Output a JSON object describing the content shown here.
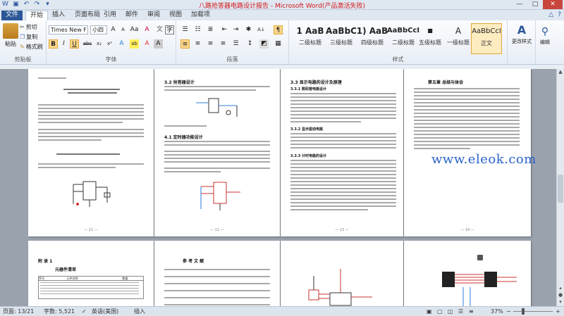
{
  "window": {
    "title": "八路抢答器电路设计报告 - Microsoft Word(产品激活失败)",
    "qat_icons": [
      "word-icon",
      "save-icon",
      "undo-icon",
      "redo-icon",
      "customize-icon"
    ],
    "controls": {
      "minimize": "—",
      "maximize": "□",
      "close": "✕"
    }
  },
  "tabs": [
    {
      "label": "文件"
    },
    {
      "label": "开始"
    },
    {
      "label": "插入"
    },
    {
      "label": "页面布局"
    },
    {
      "label": "引用"
    },
    {
      "label": "邮件"
    },
    {
      "label": "审阅"
    },
    {
      "label": "视图"
    },
    {
      "label": "加载项"
    }
  ],
  "tabs_right": {
    "minimize_ribbon": "△",
    "help": "?"
  },
  "ribbon": {
    "clipboard": {
      "label": "剪贴板",
      "paste": "粘贴",
      "cut": "剪切",
      "copy": "复制",
      "format_painter": "格式刷"
    },
    "font": {
      "label": "字体",
      "font_name": "Times New F",
      "font_size": "小四",
      "grow": "A",
      "shrink": "A",
      "case": "Aa",
      "clear": "A",
      "bold": "B",
      "italic": "I",
      "underline": "U",
      "strike": "abc",
      "sub": "x₂",
      "sup": "x²",
      "effects": "A",
      "highlight": "ab",
      "color": "A",
      "char_shade": "A",
      "enclose": "字"
    },
    "paragraph": {
      "label": "段落",
      "sort": "A↓",
      "marks": "¶"
    },
    "styles": {
      "label": "样式",
      "items": [
        {
          "sample": "1 AaB",
          "name": "二级标题"
        },
        {
          "sample": "AaBbC",
          "name": "三级标题"
        },
        {
          "sample": "1) AaB",
          "name": "四级标题"
        },
        {
          "sample": "AaBbCcI",
          "name": "二级标题"
        },
        {
          "sample": "■",
          "name": "五级标题"
        },
        {
          "sample": "A",
          "name": "一级标题"
        },
        {
          "sample": "AaBbCcI",
          "name": "正文"
        }
      ],
      "change_styles": "更改样式"
    },
    "editing": {
      "label": "编辑"
    }
  },
  "pages_row1": [
    {
      "page_num": "— 11 —"
    },
    {
      "heading": "3.2 抢答器设计",
      "sub1": "4.1 定时器功能设计",
      "page_num": "— 12 —"
    },
    {
      "heading": "3.3 显示电路的设计及原理",
      "sub1": "3.3.1 数码管电路设计",
      "sub2": "3.3.2 显示驱动电路",
      "sub3": "3.3.3 计时电路的设计",
      "page_num": "— 13 —"
    },
    {
      "heading": "第五章 总结与体会",
      "page_num": "— 14 —"
    }
  ],
  "pages_row2": [
    {
      "heading": "附 录 1",
      "sub1": "元器件清单",
      "table_header": [
        "序号",
        "元件名称",
        "数量"
      ]
    },
    {
      "heading": "参 考 文 献"
    },
    {},
    {}
  ],
  "watermark": "www.eleok.com",
  "statusbar": {
    "page": "页面: 13/21",
    "words": "字数: 5,521",
    "language": "英语(美国)",
    "mode": "插入",
    "zoom": "37%",
    "zoom_minus": "−",
    "zoom_plus": "+"
  }
}
